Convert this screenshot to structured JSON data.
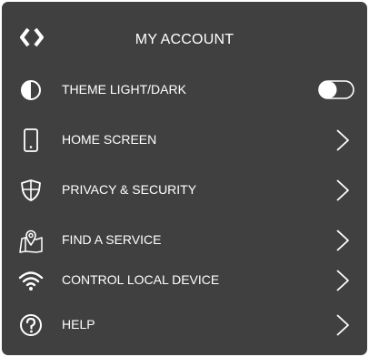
{
  "header": {
    "title": "MY ACCOUNT",
    "logo_icon": "bracket-logo-icon"
  },
  "menu": {
    "items": [
      {
        "label": "THEME LIGHT/DARK",
        "icon": "half-circle-icon",
        "control": "toggle",
        "toggle_on": false
      },
      {
        "label": "HOME SCREEN",
        "icon": "phone-icon",
        "control": "chevron"
      },
      {
        "label": "PRIVACY & SECURITY",
        "icon": "shield-icon",
        "control": "chevron"
      },
      {
        "label": "FIND A SERVICE",
        "icon": "map-pin-icon",
        "control": "chevron"
      },
      {
        "label": "CONTROL LOCAL DEVICE",
        "icon": "wifi-icon",
        "control": "chevron"
      },
      {
        "label": "HELP",
        "icon": "question-icon",
        "control": "chevron"
      }
    ]
  },
  "colors": {
    "panel_background": "#404040",
    "text": "#ffffff"
  }
}
